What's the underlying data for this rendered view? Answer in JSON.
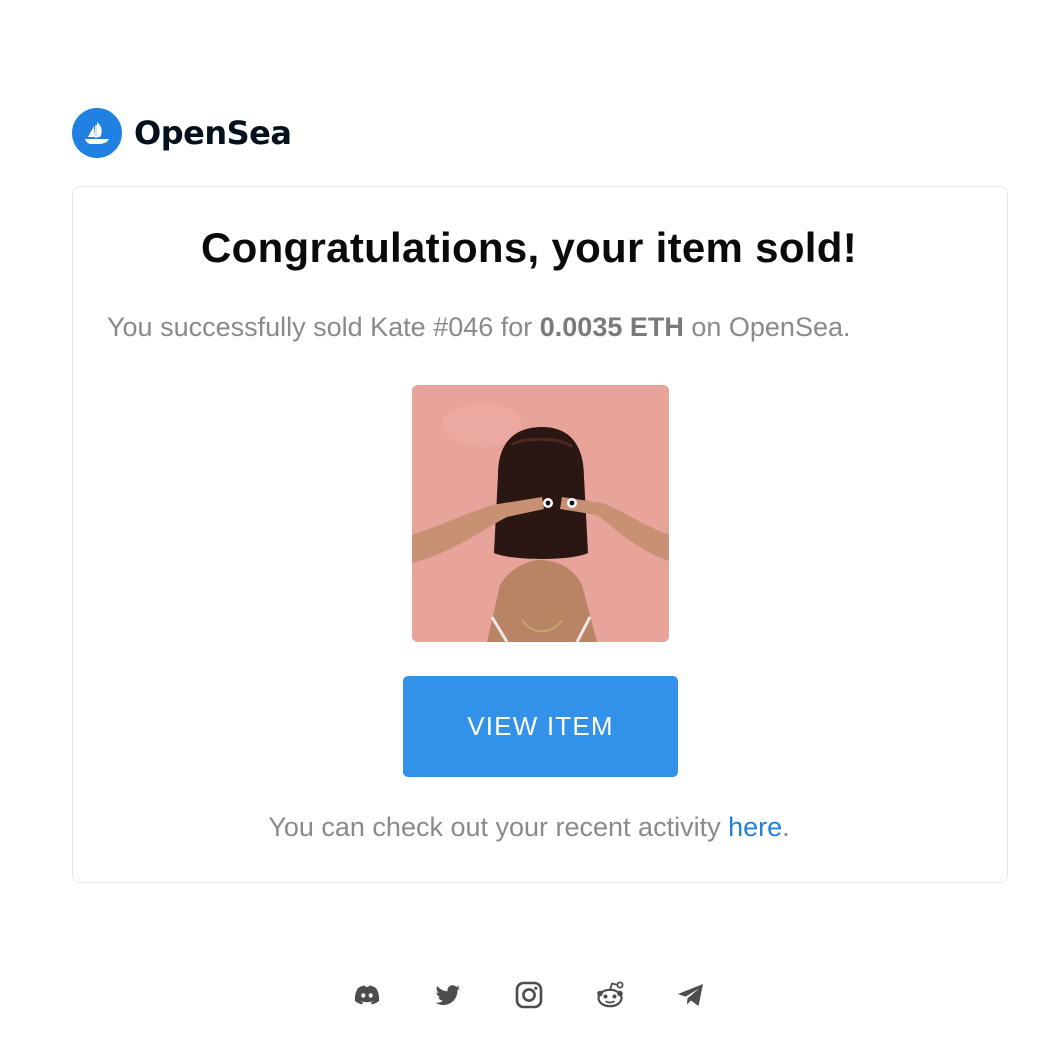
{
  "brand": {
    "name": "OpenSea",
    "logo_icon": "opensea-ship-icon",
    "color": "#2081e2"
  },
  "card": {
    "headline": "Congratulations, your item sold!",
    "summary": {
      "prefix": "You successfully sold Kate #046 for ",
      "price": "0.0035 ETH",
      "suffix": " on OpenSea."
    },
    "image": {
      "alt": "Kate #046"
    },
    "button_label": "VIEW ITEM",
    "button_color": "#3291e9",
    "activity": {
      "prefix": "You can check out your recent activity ",
      "link": "here",
      "suffix": "."
    }
  },
  "socials": [
    {
      "icon": "discord-icon"
    },
    {
      "icon": "twitter-icon"
    },
    {
      "icon": "instagram-icon"
    },
    {
      "icon": "reddit-icon"
    },
    {
      "icon": "telegram-icon"
    }
  ]
}
